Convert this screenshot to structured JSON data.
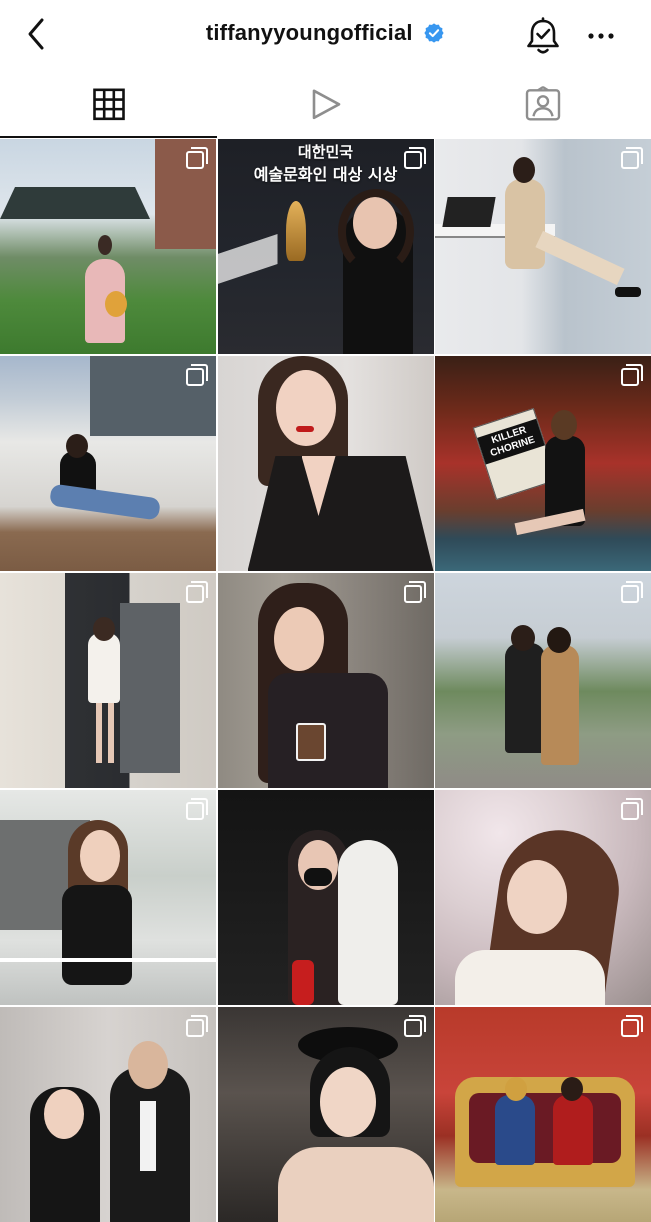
{
  "header": {
    "username": "tiffanyyoungofficial",
    "verified": true,
    "icons": {
      "back": "chevron-left-icon",
      "notification": "bell-check-icon",
      "more": "more-horizontal-icon"
    }
  },
  "tabs": [
    {
      "id": "grid",
      "icon": "grid-icon",
      "active": true
    },
    {
      "id": "reels",
      "icon": "play-icon",
      "active": false
    },
    {
      "id": "tagged",
      "icon": "tagged-person-icon",
      "active": false
    }
  ],
  "posts": [
    {
      "id": 1,
      "kind": "garden",
      "multi": true
    },
    {
      "id": 2,
      "kind": "award",
      "multi": true,
      "caption_text": [
        "대한민국",
        "예술문화인 대상 시상"
      ]
    },
    {
      "id": 3,
      "kind": "office",
      "multi": true
    },
    {
      "id": 4,
      "kind": "rooftop",
      "multi": true
    },
    {
      "id": 5,
      "kind": "portrait",
      "multi": false
    },
    {
      "id": 6,
      "kind": "theater",
      "multi": true,
      "poster_text": "KILLER CHORINE"
    },
    {
      "id": 7,
      "kind": "backstage",
      "multi": true
    },
    {
      "id": 8,
      "kind": "cafe",
      "multi": true
    },
    {
      "id": 9,
      "kind": "friends",
      "multi": true
    },
    {
      "id": 10,
      "kind": "balcony",
      "multi": true
    },
    {
      "id": 11,
      "kind": "masks",
      "multi": false
    },
    {
      "id": 12,
      "kind": "blossom",
      "multi": true
    },
    {
      "id": 13,
      "kind": "tuxedo",
      "multi": true
    },
    {
      "id": 14,
      "kind": "hat",
      "multi": true
    },
    {
      "id": 15,
      "kind": "throne",
      "multi": true
    }
  ],
  "colors": {
    "verified": "#3897f0",
    "text": "#111111",
    "divider": "#dbdbdb"
  }
}
